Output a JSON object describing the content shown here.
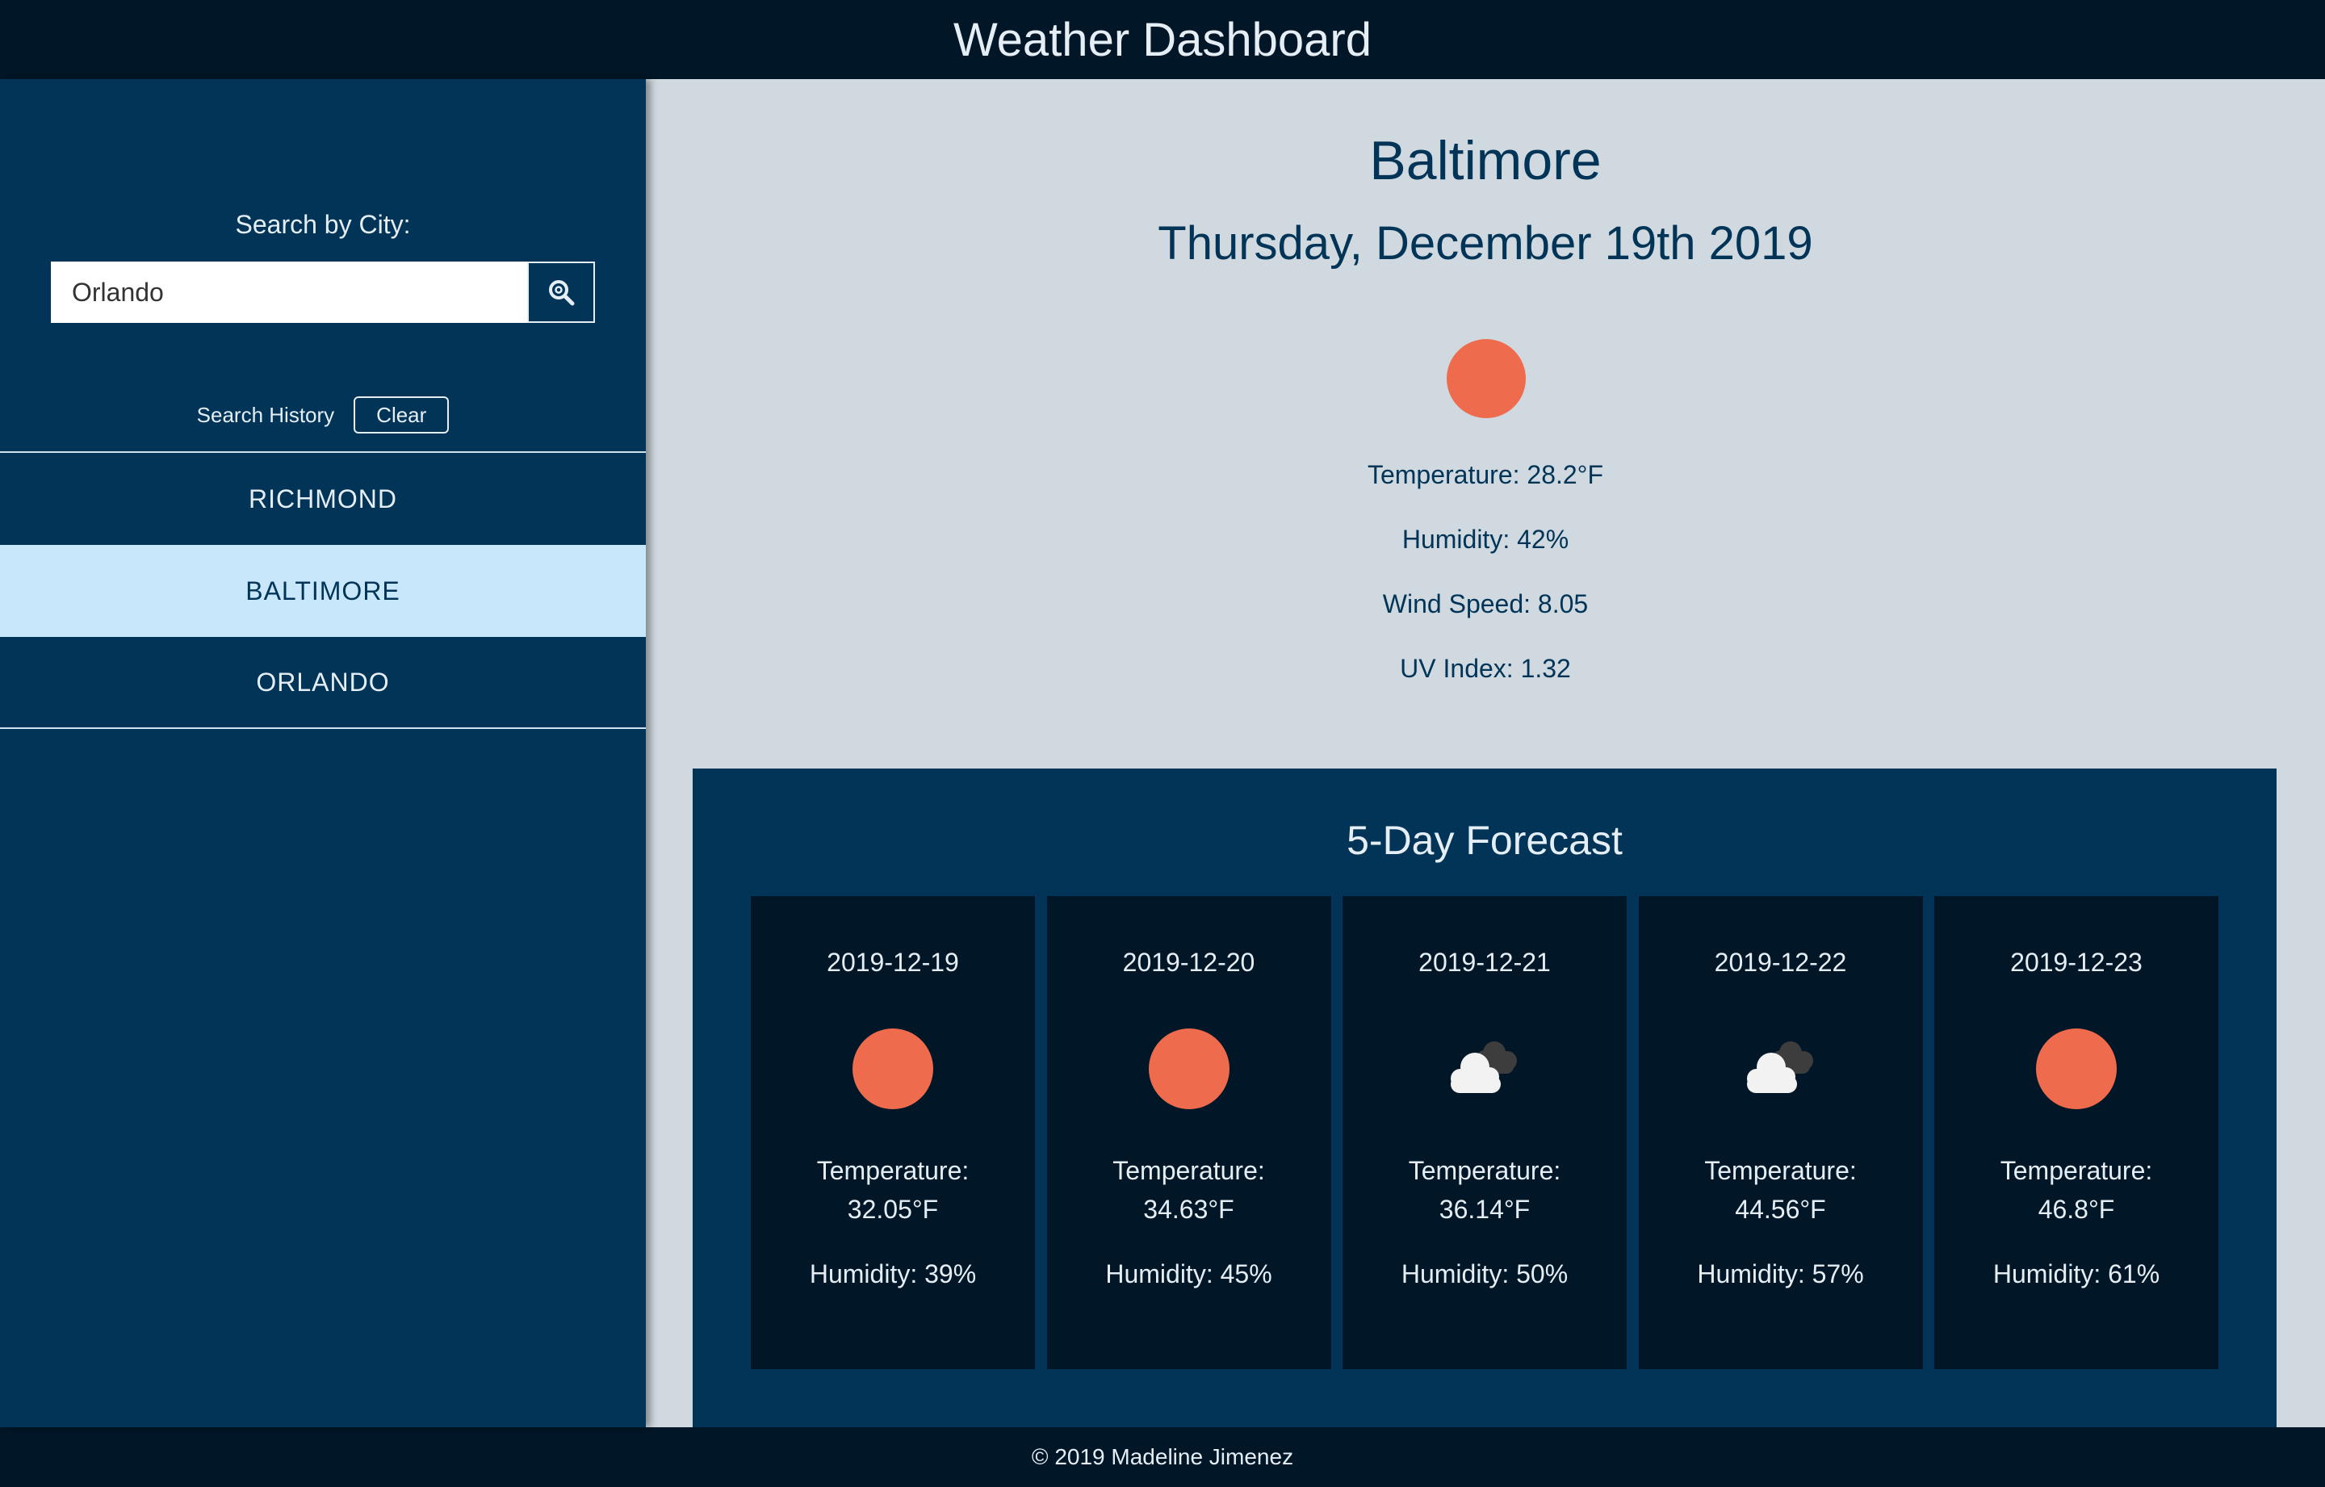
{
  "header": {
    "title": "Weather Dashboard"
  },
  "sidebar": {
    "search_label": "Search by City:",
    "search_value": "Orlando",
    "search_button_icon": "search-icon",
    "history_label": "Search History",
    "clear_label": "Clear",
    "history": [
      {
        "label": "RICHMOND",
        "active": false
      },
      {
        "label": "BALTIMORE",
        "active": true
      },
      {
        "label": "ORLANDO",
        "active": false
      }
    ]
  },
  "current": {
    "city": "Baltimore",
    "date": "Thursday, December 19th 2019",
    "icon": "sun-icon",
    "temperature": "Temperature: 28.2°F",
    "humidity": "Humidity: 42%",
    "wind": "Wind Speed: 8.05",
    "uv": "UV Index: 1.32"
  },
  "forecast": {
    "title": "5-Day Forecast",
    "temp_label": "Temperature:",
    "days": [
      {
        "date": "2019-12-19",
        "icon": "sun-icon",
        "temp": "32.05°F",
        "humidity": "Humidity: 39%"
      },
      {
        "date": "2019-12-20",
        "icon": "sun-icon",
        "temp": "34.63°F",
        "humidity": "Humidity: 45%"
      },
      {
        "date": "2019-12-21",
        "icon": "cloud-icon",
        "temp": "36.14°F",
        "humidity": "Humidity: 50%"
      },
      {
        "date": "2019-12-22",
        "icon": "cloud-icon",
        "temp": "44.56°F",
        "humidity": "Humidity: 57%"
      },
      {
        "date": "2019-12-23",
        "icon": "sun-icon",
        "temp": "46.8°F",
        "humidity": "Humidity: 61%"
      }
    ]
  },
  "footer": {
    "text": "© 2019 Madeline Jimenez"
  },
  "colors": {
    "accent": "#ee6c4d",
    "navy": "#023458",
    "dark": "#011627",
    "active_bg": "#c9e7fb",
    "page_bg": "#cfd9df"
  }
}
